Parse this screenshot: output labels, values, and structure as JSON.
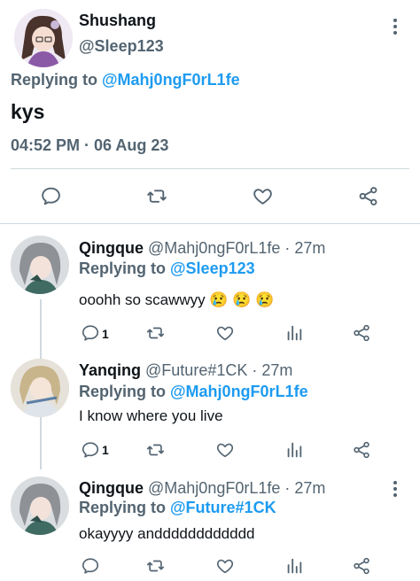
{
  "main_tweet": {
    "author_name": "Shushang",
    "author_handle": "@Sleep123",
    "replying_prefix": "Replying to ",
    "replying_to": "@Mahj0ngF0rL1fe",
    "text": "kys",
    "timestamp": "04:52 PM · 06 Aug 23",
    "actions": [
      "reply-icon",
      "retweet-icon",
      "like-icon",
      "share-icon"
    ]
  },
  "replies": [
    {
      "author_name": "Qingque",
      "author_handle": "@Mahj0ngF0rL1fe",
      "time": "· 27m",
      "replying_prefix": "Replying to ",
      "replying_to": "@Sleep123",
      "text": "ooohh so scawwyy 😢 😢 😢",
      "reply_count": "1",
      "actions": [
        "reply-icon",
        "retweet-icon",
        "like-icon",
        "views-icon",
        "share-icon"
      ]
    },
    {
      "author_name": "Yanqing",
      "author_handle": "@Future#1CK",
      "time": "· 27m",
      "replying_prefix": "Replying to ",
      "replying_to": "@Mahj0ngF0rL1fe",
      "text": "I know where you live",
      "reply_count": "1",
      "actions": [
        "reply-icon",
        "retweet-icon",
        "like-icon",
        "views-icon",
        "share-icon"
      ]
    },
    {
      "author_name": "Qingque",
      "author_handle": "@Mahj0ngF0rL1fe",
      "time": "· 27m",
      "replying_prefix": "Replying to ",
      "replying_to": "@Future#1CK",
      "text": "okayyyy andddddddddddd",
      "reply_count": "",
      "actions": [
        "reply-icon",
        "retweet-icon",
        "like-icon",
        "views-icon",
        "share-icon"
      ]
    }
  ],
  "colors": {
    "text": "#0f1419",
    "secondary": "#536471",
    "link": "#1d9bf0",
    "divider": "#cfd9de"
  }
}
